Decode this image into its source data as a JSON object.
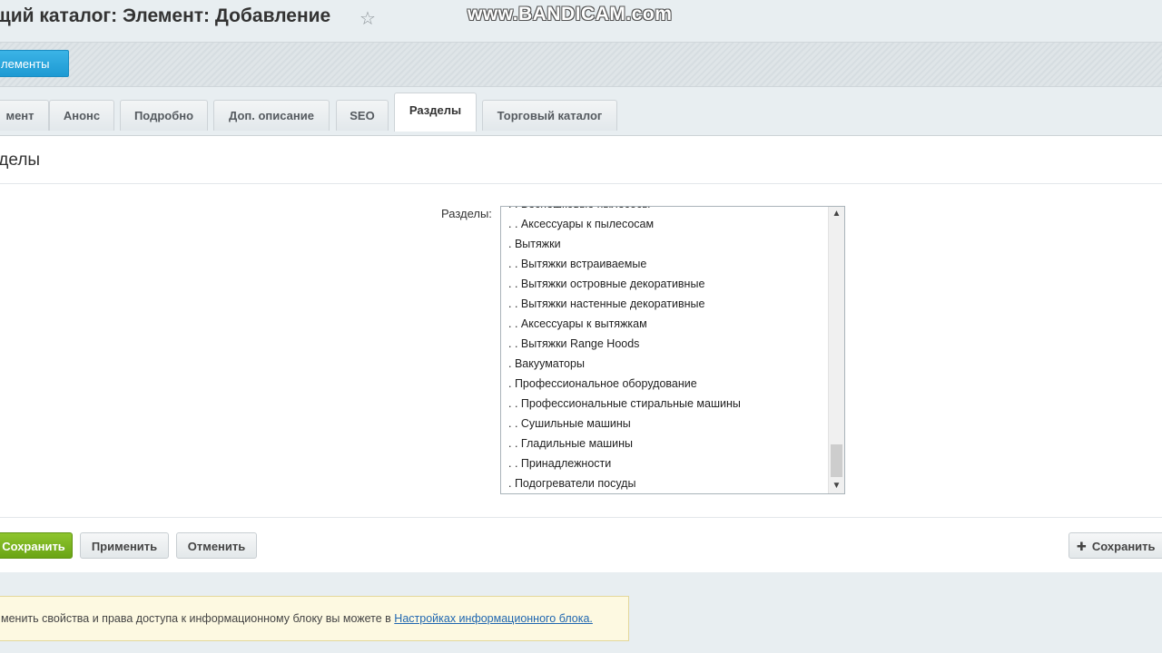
{
  "header": {
    "title": "щий каталог: Элемент: Добавление",
    "watermark": "www.BANDICAM.com"
  },
  "toolbar": {
    "elements_button": "лементы"
  },
  "tabs": [
    {
      "label": "мент"
    },
    {
      "label": "Анонс"
    },
    {
      "label": "Подробно"
    },
    {
      "label": "Доп. описание"
    },
    {
      "label": "SEO"
    },
    {
      "label": "Разделы"
    },
    {
      "label": "Торговый каталог"
    }
  ],
  "active_tab": "Разделы",
  "section": {
    "title": "зделы",
    "field_label": "Разделы:"
  },
  "sections_list": [
    ". . Беспешковые пылесосы",
    ". . Аксессуары к пылесосам",
    ". Вытяжки",
    ". . Вытяжки встраиваемые",
    ". . Вытяжки островные декоративные",
    ". . Вытяжки настенные декоративные",
    ". . Аксессуары к вытяжкам",
    ". . Вытяжки Range Hoods",
    ". Вакууматоры",
    ". Профессиональное оборудование",
    ". . Профессиональные стиральные машины",
    ". . Сушильные машины",
    ". . Гладильные машины",
    ". . Принадлежности",
    ". Подогреватели посуды"
  ],
  "actions": {
    "save": "Сохранить",
    "apply": "Применить",
    "cancel": "Отменить",
    "save_add": "Сохранить"
  },
  "note": {
    "text": "менить свойства и права доступа к информационному блоку вы можете в ",
    "link": "Настройках информационного блока."
  },
  "icons": {
    "star": "star-icon",
    "plus": "plus-icon"
  },
  "colors": {
    "primary_button": "#1d9ad3",
    "save_button": "#6aa415",
    "link": "#2067b0"
  }
}
